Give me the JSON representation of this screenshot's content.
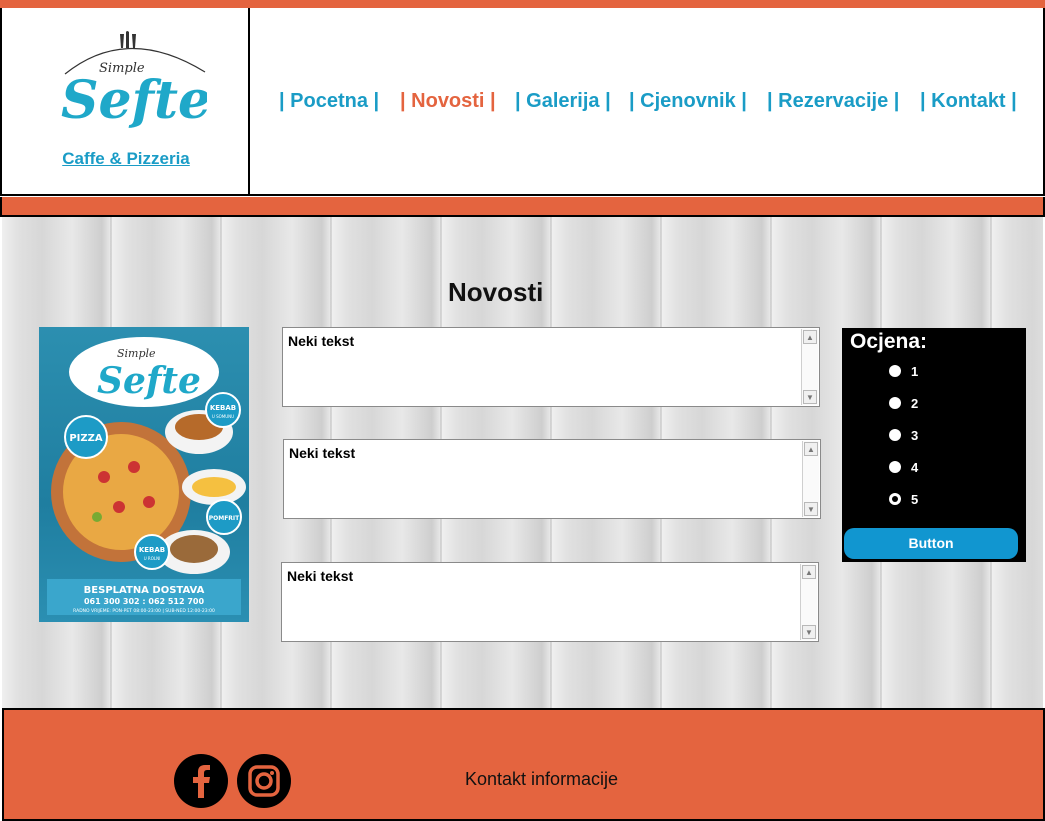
{
  "header": {
    "logo_script": "Simple",
    "logo_name": "Sefte",
    "logo_link": "Caffe & Pizzeria"
  },
  "nav": [
    {
      "label": "| Pocetna |",
      "active": false
    },
    {
      "label": "| Novosti |",
      "active": true
    },
    {
      "label": "| Galerija |",
      "active": false
    },
    {
      "label": "| Cjenovnik |",
      "active": false
    },
    {
      "label": "| Rezervacije |",
      "active": false
    },
    {
      "label": "| Kontakt |",
      "active": false
    }
  ],
  "main": {
    "title": "Novosti",
    "news": [
      {
        "text": "Neki tekst"
      },
      {
        "text": "Neki tekst"
      },
      {
        "text": "Neki tekst"
      }
    ]
  },
  "poster": {
    "script": "Simple",
    "name": "Sefte",
    "badges": [
      "PIZZA",
      "KEBAB",
      "POMFRIT",
      "KEBAB"
    ],
    "badge_subs": [
      "U SOMUNU",
      "U ROLNI"
    ],
    "delivery": "BESPLATNA DOSTAVA",
    "phones": "061 300 302 : 062 512 700",
    "hours": "RADNO VRIJEME: PON-PET 08:00-23:00 | SUB-NED 12:00-23:00"
  },
  "rating": {
    "title": "Ocjena:",
    "options": [
      "1",
      "2",
      "3",
      "4",
      "5"
    ],
    "selected": "5",
    "button_label": "Button"
  },
  "footer": {
    "contact": "Kontakt informacije",
    "social": [
      "facebook-icon",
      "instagram-icon"
    ]
  },
  "colors": {
    "accent_orange": "#e4643f",
    "link_blue": "#1a9cc6",
    "button_blue": "#1196d0"
  }
}
